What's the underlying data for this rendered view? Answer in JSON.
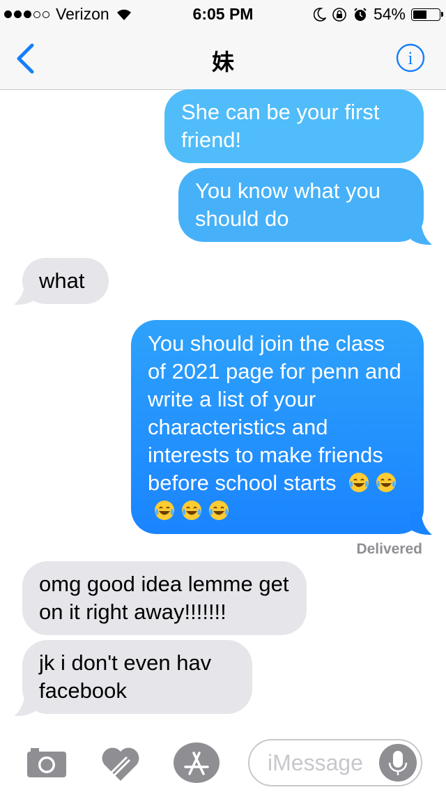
{
  "status_bar": {
    "carrier": "Verizon",
    "time": "6:05 PM",
    "battery": "54%",
    "battery_level": 0.54,
    "signal_bars": 3,
    "signal_total": 5
  },
  "nav": {
    "title": "妹",
    "back_icon": "chevron-left-icon",
    "info_icon": "info-icon"
  },
  "messages": [
    {
      "direction": "sent",
      "text": "She can be your first friend!"
    },
    {
      "direction": "sent",
      "text": "You know what you should do"
    },
    {
      "direction": "received",
      "text": "what"
    },
    {
      "direction": "sent",
      "text": "You should join the class of 2021 page for penn and write a list of your characteristics and interests to make friends before school starts",
      "emoji": "😂😂😂😂😂"
    },
    {
      "direction": "received",
      "text": "omg good idea lemme get on it right away!!!!!!!"
    },
    {
      "direction": "received",
      "text": "jk i don't even hav facebook"
    }
  ],
  "delivered_label": "Delivered",
  "input_bar": {
    "placeholder": "iMessage",
    "icons": [
      "camera-icon",
      "digital-touch-icon",
      "app-store-icon",
      "microphone-icon"
    ]
  },
  "colors": {
    "sent_top": "#5ac8fa",
    "sent_bottom": "#1a84ff",
    "received": "#e5e5ea",
    "ios_blue": "#147efb"
  }
}
